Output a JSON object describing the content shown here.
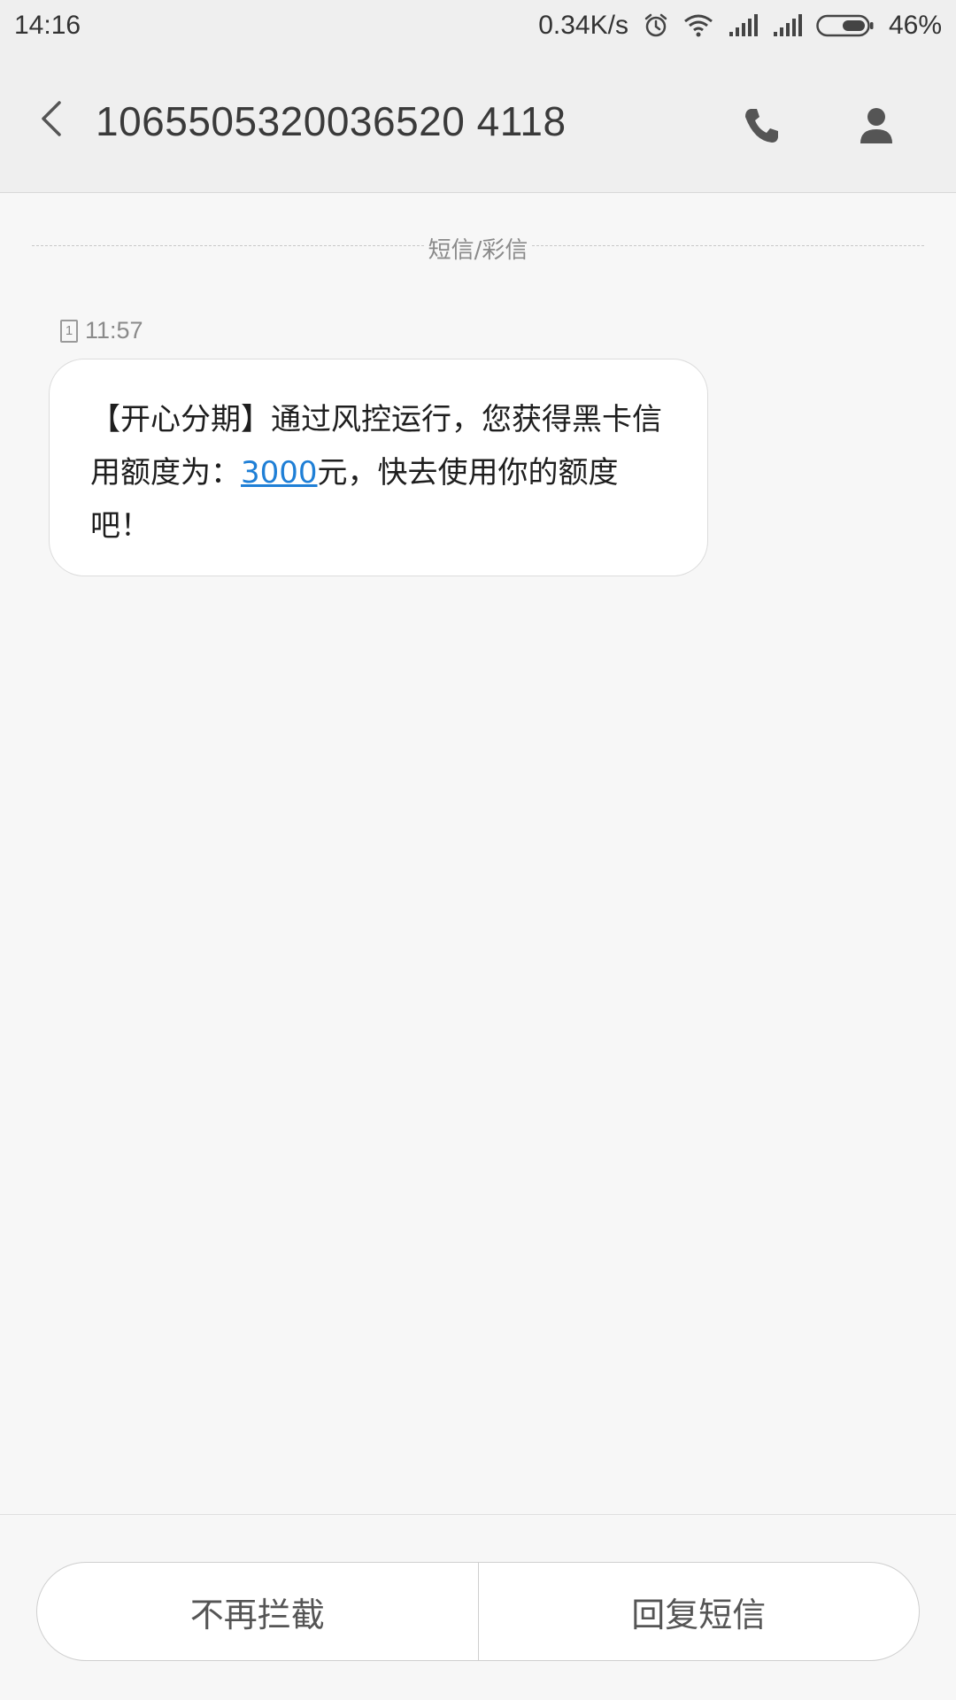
{
  "status_bar": {
    "time": "14:16",
    "network_speed": "0.34K/s",
    "battery_level": "46%",
    "icons": [
      "alarm-icon",
      "wifi-icon",
      "signal-icon",
      "signal-icon",
      "battery-icon"
    ]
  },
  "header": {
    "title": "1065505320036520 4118",
    "back_icon": "chevron-left-icon",
    "call_icon": "phone-icon",
    "contact_icon": "person-icon"
  },
  "conversation": {
    "divider_label": "短信/彩信",
    "messages": [
      {
        "sim": "1",
        "time": "11:57",
        "text_before": "【开心分期】通过风控运行，您获得黑卡信用额度为：",
        "amount": "3000",
        "text_after": "元，快去使用你的额度吧！"
      }
    ]
  },
  "actions": {
    "block_label": "不再拦截",
    "reply_label": "回复短信"
  },
  "colors": {
    "link": "#1f7fd6",
    "background": "#f7f7f7",
    "header_bg": "#efefef"
  }
}
